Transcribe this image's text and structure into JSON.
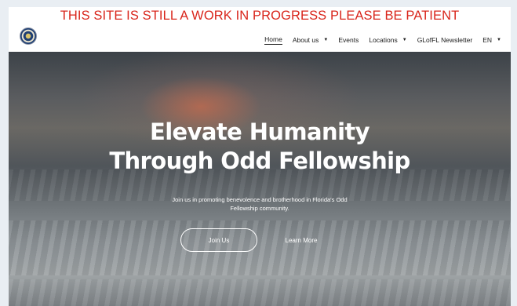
{
  "banner": {
    "text": "THIS SITE IS STILL A WORK IN PROGRESS PLEASE BE PATIENT"
  },
  "nav": {
    "items": [
      {
        "label": "Home",
        "active": true,
        "dropdown": false
      },
      {
        "label": "About us",
        "active": false,
        "dropdown": true
      },
      {
        "label": "Events",
        "active": false,
        "dropdown": false
      },
      {
        "label": "Locations",
        "active": false,
        "dropdown": true
      },
      {
        "label": "GLofFL Newsletter",
        "active": false,
        "dropdown": false
      },
      {
        "label": "EN",
        "active": false,
        "dropdown": true
      }
    ],
    "caret": "▼"
  },
  "hero": {
    "title_line1": "Elevate Humanity",
    "title_line2": "Through Odd Fellowship",
    "subtitle": "Join us in promoting benevolence and brotherhood in Florida's Odd Fellowship community.",
    "join_label": "Join Us",
    "learn_label": "Learn More"
  },
  "colors": {
    "banner": "#d9261c",
    "nav_text": "#1a1a1a",
    "hero_text": "#ffffff"
  },
  "icons": {
    "logo": "lodge-seal-icon"
  }
}
